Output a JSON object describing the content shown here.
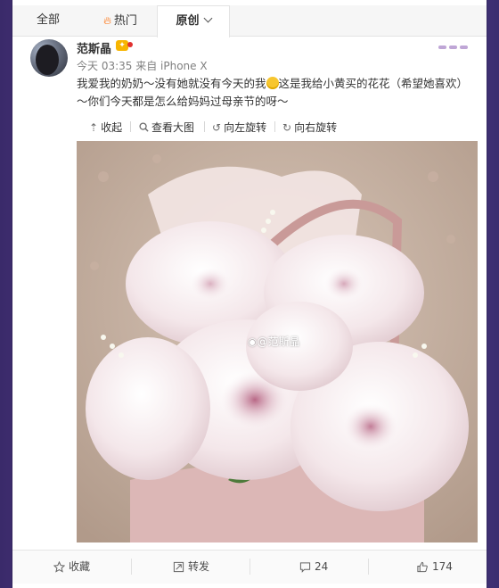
{
  "tabs": [
    {
      "label": "全部"
    },
    {
      "label": "热门"
    },
    {
      "label": "原创"
    }
  ],
  "post": {
    "user": "范斯晶",
    "meta": "今天 03:35 来自 iPhone X",
    "text_1": "我爱我的奶奶～没有她就没有今天的我",
    "text_2": "这是我给小黄买的花花（希望她喜欢）～你们今天都是怎么给妈妈过母亲节的呀～"
  },
  "tools": {
    "collapse": "收起",
    "view_large": "查看大图",
    "rotate_left": "向左旋转",
    "rotate_right": "向右旋转"
  },
  "photo": {
    "watermark": "@范斯晶"
  },
  "footer": {
    "favorite": "收藏",
    "repost": "转发",
    "comments": "24",
    "likes": "174"
  },
  "colors": {
    "accent": "#ff6a00",
    "badge": "#f7b500"
  },
  "icons": [
    "fire-icon",
    "chevron-down-icon",
    "collapse-arrow-icon",
    "magnify-icon",
    "rotate-left-icon",
    "rotate-right-icon",
    "star-icon",
    "repost-icon",
    "comment-icon",
    "thumbs-up-icon",
    "weibo-watermark-icon"
  ]
}
